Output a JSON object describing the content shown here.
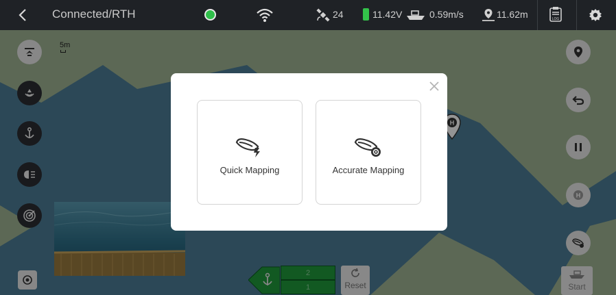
{
  "topbar": {
    "title": "Connected/RTH",
    "satellites": "24",
    "voltage": "11.42V",
    "speed": "0.59m/s",
    "distance": "11.62m",
    "status_color": "#2fbf4a",
    "battery_color": "#33c24a"
  },
  "map": {
    "scale_label": "5m",
    "water_color": "#4d7d96",
    "land_color": "#9fb493"
  },
  "controls": {
    "counter_top": "2",
    "counter_bottom": "1",
    "reset_label": "Reset",
    "start_label": "Start"
  },
  "dialog": {
    "quick_label": "Quick Mapping",
    "accurate_label": "Accurate Mapping"
  }
}
